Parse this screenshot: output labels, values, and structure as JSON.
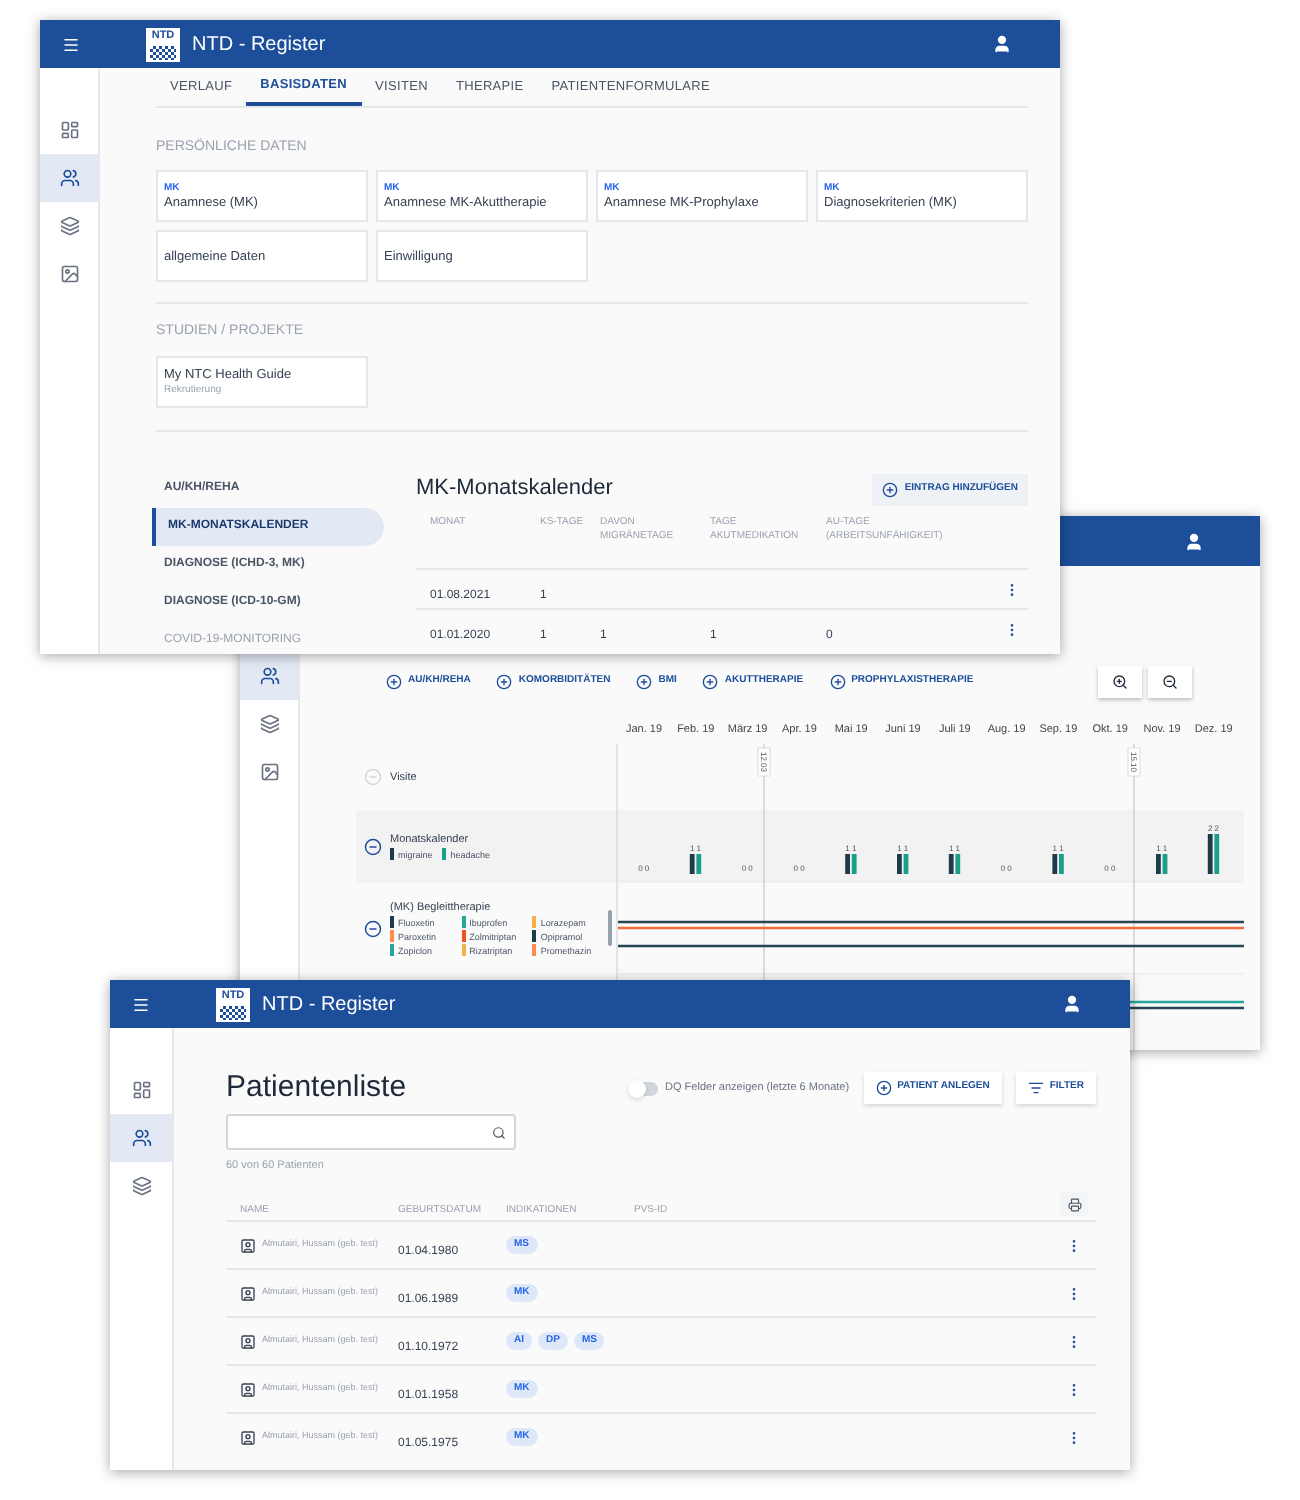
{
  "register_window": {
    "title": "NTD - Register",
    "logo_text": "NTD",
    "sidebar": [
      {
        "kind": "dashboard",
        "selected": false
      },
      {
        "kind": "people",
        "selected": true
      },
      {
        "kind": "layers",
        "selected": false
      },
      {
        "kind": "image",
        "selected": false
      }
    ],
    "tabs": [
      {
        "label": "VERLAUF",
        "selected": false
      },
      {
        "label": "BASISDATEN",
        "selected": true
      },
      {
        "label": "VISITEN",
        "selected": false
      },
      {
        "label": "THERAPIE",
        "selected": false
      },
      {
        "label": "PATIENTENFORMULARE",
        "selected": false
      }
    ],
    "personal_section": {
      "heading": "PERSÖNLICHE DATEN",
      "cards": [
        {
          "tag": "MK",
          "title": "Anamnese (MK)"
        },
        {
          "tag": "MK",
          "title": "Anamnese MK-Akuttherapie"
        },
        {
          "tag": "MK",
          "title": "Anamnese MK-Prophylaxe"
        },
        {
          "tag": "MK",
          "title": "Diagnosekriterien (MK)"
        },
        {
          "title": "allgemeine Daten"
        },
        {
          "title": "Einwilligung"
        }
      ]
    },
    "studies_section": {
      "heading": "STUDIEN / PROJEKTE",
      "cards": [
        {
          "title": "My NTC Health Guide",
          "subtitle": "Rekrutierung"
        }
      ]
    },
    "nav": [
      {
        "label": "AU/KH/REHA",
        "selected": false,
        "disabled": false
      },
      {
        "label": "MK-MONATSKALENDER",
        "selected": true,
        "disabled": false
      },
      {
        "label": "DIAGNOSE (ICHD-3, MK)",
        "selected": false,
        "disabled": false
      },
      {
        "label": "DIAGNOSE (ICD-10-GM)",
        "selected": false,
        "disabled": false
      },
      {
        "label": "COVID-19-MONITORING",
        "selected": false,
        "disabled": true
      }
    ],
    "calendar": {
      "title": "MK-Monatskalender",
      "add_button": "EINTRAG HINZUFÜGEN",
      "columns": [
        "MONAT",
        "KS-TAGE",
        "DAVON MIGRÄNETAGE",
        "TAGE AKUTMEDIKATION",
        "AU-TAGE (ARBEITSUNFÄHIGKEIT)"
      ],
      "rows": [
        {
          "cells": [
            "01.08.2021",
            "1"
          ]
        },
        {
          "cells": [
            "01.01.2020",
            "1",
            "1",
            "1",
            "0"
          ]
        }
      ]
    }
  },
  "timeline_window": {
    "sidebar": [
      {
        "kind": "people",
        "selected": true
      },
      {
        "kind": "layers",
        "selected": false
      },
      {
        "kind": "image",
        "selected": false
      }
    ],
    "toolbar": [
      "AU/KH/REHA",
      "KOMORBIDITÄTEN",
      "BMI",
      "AKUTTHERAPIE",
      "PROPHYLAXISTHERAPIE"
    ],
    "rows": [
      {
        "kind": "visits",
        "label": "Visite",
        "disabled": true
      },
      {
        "kind": "calendar",
        "label": "Monatskalender",
        "disabled": false
      },
      {
        "kind": "therapy",
        "label": "(MK) Begleittherapie",
        "disabled": false,
        "legend": [
          {
            "label": "Fluoxetin",
            "color": "#1f3a4a"
          },
          {
            "label": "Ibuprofen",
            "color": "#26a69a"
          },
          {
            "label": "Lorazepam",
            "color": "#f6b04a"
          },
          {
            "label": "Paroxetin",
            "color": "#ff8a50"
          },
          {
            "label": "Zolmitriptan",
            "color": "#f4511e"
          },
          {
            "label": "Opipramol",
            "color": "#16404a"
          },
          {
            "label": "Zopiclon",
            "color": "#26a69a"
          },
          {
            "label": "Rizatriptan",
            "color": "#f6b04a"
          },
          {
            "label": "Promethazin",
            "color": "#ff8a50"
          }
        ]
      }
    ],
    "markers": [
      "12.03",
      "15.10"
    ],
    "chart_data": {
      "type": "bar",
      "categories": [
        "Jan. 19",
        "Feb. 19",
        "März 19",
        "Apr. 19",
        "Mai 19",
        "Juni 19",
        "Juli 19",
        "Aug. 19",
        "Sep. 19",
        "Okt. 19",
        "Nov. 19",
        "Dez. 19"
      ],
      "series": [
        {
          "name": "migraine",
          "color": "#1f3a4a",
          "values": [
            0,
            1,
            0,
            0,
            1,
            1,
            1,
            0,
            1,
            0,
            1,
            2
          ]
        },
        {
          "name": "headache",
          "color": "#1aa08a",
          "values": [
            0,
            1,
            0,
            0,
            1,
            1,
            1,
            0,
            1,
            0,
            1,
            2
          ]
        }
      ],
      "data_labels": true
    }
  },
  "patient_window": {
    "title": "NTD - Register",
    "logo_text": "NTD",
    "sidebar": [
      {
        "kind": "dashboard",
        "selected": false
      },
      {
        "kind": "people",
        "selected": true
      },
      {
        "kind": "layers",
        "selected": false
      }
    ],
    "heading": "Patientenliste",
    "dq_toggle": {
      "label": "DQ Felder anzeigen (letzte 6 Monate)",
      "on": false
    },
    "buttons": [
      {
        "kind": "add",
        "label": "PATIENT ANLEGEN"
      },
      {
        "kind": "filter",
        "label": "FILTER"
      }
    ],
    "count": "60 von 60 Patienten",
    "columns": [
      "NAME",
      "GEBURTSDATUM",
      "INDIKATIONEN",
      "PVS-ID"
    ],
    "rows": [
      {
        "name": "Almutairi, Hussam (geb. test)",
        "birthdate": "01.04.1980",
        "indications": [
          "MS"
        ]
      },
      {
        "name": "Almutairi, Hussam (geb. test)",
        "birthdate": "01.06.1989",
        "indications": [
          "MK"
        ]
      },
      {
        "name": "Almutairi, Hussam (geb. test)",
        "birthdate": "01.10.1972",
        "indications": [
          "AI",
          "DP",
          "MS"
        ]
      },
      {
        "name": "Almutairi, Hussam (geb. test)",
        "birthdate": "01.01.1958",
        "indications": [
          "MK"
        ]
      },
      {
        "name": "Almutairi, Hussam (geb. test)",
        "birthdate": "01.05.1975",
        "indications": [
          "MK"
        ]
      }
    ]
  }
}
